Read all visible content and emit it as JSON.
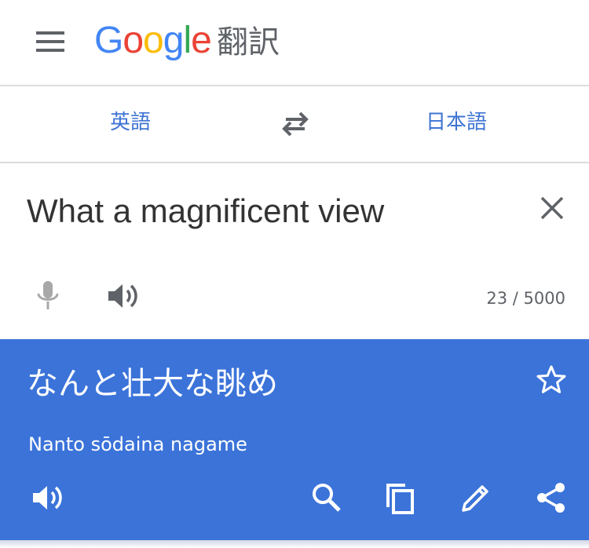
{
  "header": {
    "logo_text": "Google",
    "app_suffix": "翻訳",
    "menu_icon": "hamburger-icon"
  },
  "languages": {
    "source": "英語",
    "target": "日本語",
    "swap_icon": "swap-arrows-icon"
  },
  "input": {
    "text": "What a magnificent view",
    "char_count": "23 / 5000",
    "icons": [
      "close-icon",
      "microphone-icon",
      "speaker-icon"
    ]
  },
  "output": {
    "translation": "なんと壮大な眺め",
    "romanization": "Nanto sōdaina nagame",
    "icons": [
      "star-outline-icon",
      "speaker-icon",
      "search-icon",
      "copy-icon",
      "edit-icon",
      "share-icon"
    ],
    "background_color": "#3b73d9"
  },
  "colors": {
    "accent": "#3f74d4",
    "text_dark": "#333333",
    "icon_grey": "#5f6368"
  }
}
